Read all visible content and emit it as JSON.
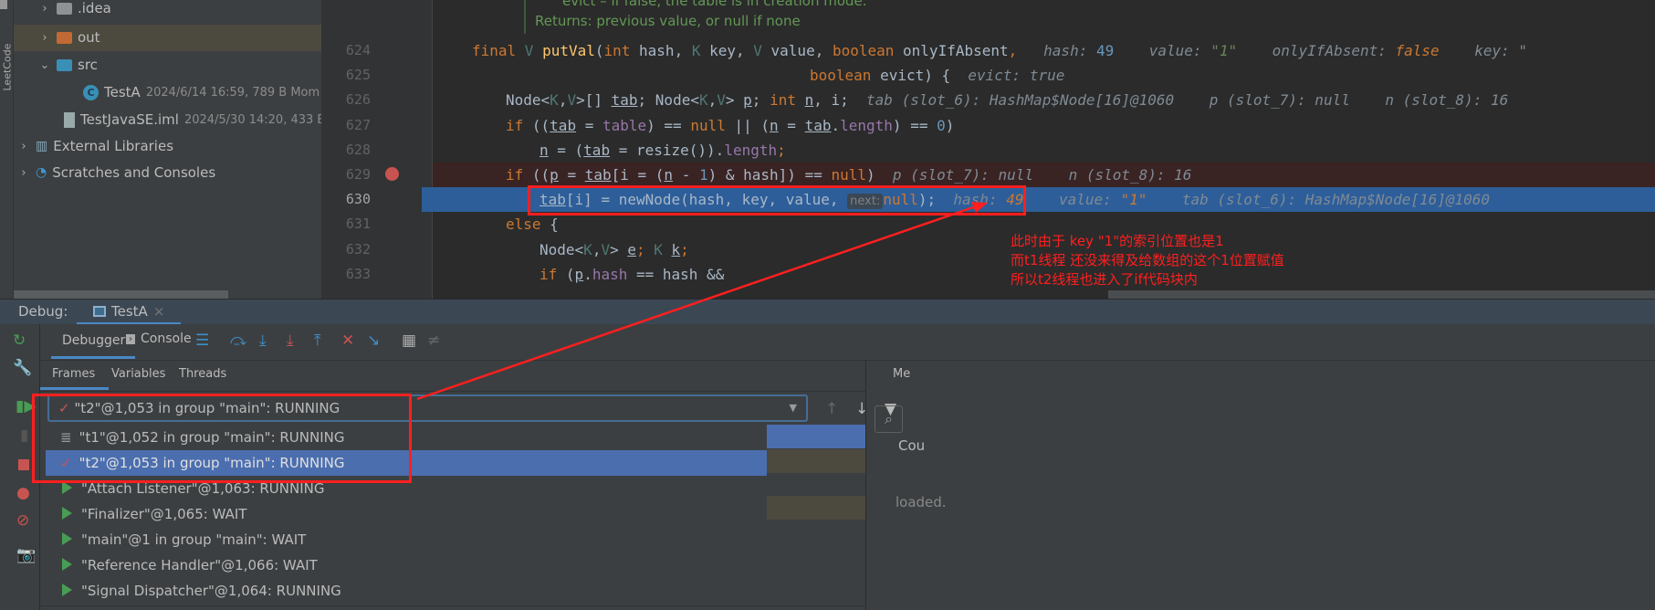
{
  "project_tree": [
    {
      "label": ".idea",
      "icon": "folder-icon",
      "color": "#8c9296",
      "expanded": false
    },
    {
      "label": "out",
      "icon": "folder-icon",
      "color": "#c26a35",
      "expanded": false,
      "selected": true
    },
    {
      "label": "src",
      "icon": "folder-icon",
      "color": "#3a8fb7",
      "expanded": true
    },
    {
      "label": "TestA",
      "meta": "2024/6/14 16:59, 789 B Mom",
      "icon": "java-class-icon"
    },
    {
      "label": "TestJavaSE.iml",
      "meta": "2024/5/30 14:20, 433 B",
      "icon": "iml-file-icon"
    },
    {
      "label": "External Libraries",
      "icon": "library-icon",
      "expanded": false
    },
    {
      "label": "Scratches and Consoles",
      "icon": "scratches-icon",
      "expanded": false
    }
  ],
  "side_label": "LeetCode",
  "doc": {
    "line1": "evict – if false, the table is in creation mode.",
    "line2": "Returns: previous value, or null if none"
  },
  "code_lines": [
    {
      "no": "624",
      "tokens": [
        [
          "k",
          "final "
        ],
        [
          "t",
          "V "
        ],
        [
          "m",
          "putVal"
        ],
        [
          "p",
          "("
        ],
        [
          "k",
          "int "
        ],
        [
          "p",
          "hash, "
        ],
        [
          "t",
          "K "
        ],
        [
          "p",
          "key, "
        ],
        [
          "t",
          "V "
        ],
        [
          "p",
          "value, "
        ],
        [
          "k",
          "boolean "
        ],
        [
          "p",
          "onlyIfAbsent"
        ],
        [
          "k",
          ","
        ],
        [
          "h",
          "   hash: "
        ],
        [
          "n",
          "49"
        ],
        [
          "h",
          "    value: "
        ],
        [
          "hs",
          "\"1\""
        ],
        [
          "h",
          "    onlyIfAbsent: "
        ],
        [
          "hv",
          "false"
        ],
        [
          "h",
          "    key: \""
        ]
      ],
      "indent": 0
    },
    {
      "no": "625",
      "tokens": [
        [
          "k",
          "boolean "
        ],
        [
          "p",
          "evict) {"
        ],
        [
          "h",
          "  evict: true"
        ]
      ],
      "indent": 10
    },
    {
      "no": "626",
      "tokens": [
        [
          "p",
          "Node<"
        ],
        [
          "t",
          "K"
        ],
        [
          "p",
          ","
        ],
        [
          "t",
          "V"
        ],
        [
          "p",
          ">[] "
        ],
        [
          "u",
          "tab"
        ],
        [
          "p",
          "; Node<"
        ],
        [
          "t",
          "K"
        ],
        [
          "p",
          ","
        ],
        [
          "t",
          "V"
        ],
        [
          "p",
          "> "
        ],
        [
          "u",
          "p"
        ],
        [
          "p",
          "; "
        ],
        [
          "k",
          "int "
        ],
        [
          "u",
          "n"
        ],
        [
          "p",
          ", i;"
        ],
        [
          "h",
          "  tab (slot_6): HashMap$Node[16]@1060    p (slot_7): null    n (slot_8): 16"
        ]
      ],
      "indent": 1
    },
    {
      "no": "627",
      "tokens": [
        [
          "k",
          "if "
        ],
        [
          "p",
          "(("
        ],
        [
          "u",
          "tab"
        ],
        [
          "p",
          " = "
        ],
        [
          "f",
          "table"
        ],
        [
          "p",
          ") == "
        ],
        [
          "k",
          "null "
        ],
        [
          "p",
          "|| ("
        ],
        [
          "u",
          "n"
        ],
        [
          "p",
          " = "
        ],
        [
          "u",
          "tab"
        ],
        [
          "p",
          "."
        ],
        [
          "f",
          "length"
        ],
        [
          "p",
          ") == "
        ],
        [
          "n",
          "0"
        ],
        [
          "p",
          ")"
        ]
      ],
      "indent": 1
    },
    {
      "no": "628",
      "tokens": [
        [
          "u",
          "n"
        ],
        [
          "p",
          " = ("
        ],
        [
          "u",
          "tab"
        ],
        [
          "p",
          " = resize())."
        ],
        [
          "f",
          "length"
        ],
        [
          "k",
          ";"
        ]
      ],
      "indent": 2
    },
    {
      "no": "629",
      "tokens": [
        [
          "k",
          "if "
        ],
        [
          "p",
          "(("
        ],
        [
          "u",
          "p"
        ],
        [
          "p",
          " = "
        ],
        [
          "u",
          "tab"
        ],
        [
          "p",
          "[i = ("
        ],
        [
          "u",
          "n"
        ],
        [
          "p",
          " - "
        ],
        [
          "n",
          "1"
        ],
        [
          "p",
          ") & hash]) == "
        ],
        [
          "k",
          "null"
        ],
        [
          "p",
          ")"
        ],
        [
          "h",
          "  p (slot_7): null    n (slot_8): 16"
        ]
      ],
      "indent": 1,
      "breakpoint": true
    },
    {
      "no": "630",
      "tokens": [
        [
          "u",
          "tab"
        ],
        [
          "p",
          "[i] = newNode(hash, key, value, "
        ],
        [
          "hint",
          "next:"
        ],
        [
          "k",
          "null"
        ],
        [
          "p",
          ");"
        ],
        [
          "h",
          "  hash: "
        ],
        [
          "hv",
          "49"
        ],
        [
          "h",
          "    value: "
        ],
        [
          "hv",
          "\"1\""
        ],
        [
          "h",
          "    tab (slot_6): HashMap$Node[16]@1060"
        ]
      ],
      "indent": 2,
      "current": true
    },
    {
      "no": "631",
      "tokens": [
        [
          "k",
          "else "
        ],
        [
          "p",
          "{"
        ]
      ],
      "indent": 1
    },
    {
      "no": "632",
      "tokens": [
        [
          "p",
          "Node<"
        ],
        [
          "t",
          "K"
        ],
        [
          "p",
          ","
        ],
        [
          "t",
          "V"
        ],
        [
          "p",
          "> "
        ],
        [
          "u",
          "e"
        ],
        [
          "k",
          "; "
        ],
        [
          "t",
          "K "
        ],
        [
          "u",
          "k"
        ],
        [
          "k",
          ";"
        ]
      ],
      "indent": 2
    },
    {
      "no": "633",
      "tokens": [
        [
          "k",
          "if "
        ],
        [
          "p",
          "("
        ],
        [
          "u",
          "p"
        ],
        [
          "p",
          "."
        ],
        [
          "f",
          "hash"
        ],
        [
          "p",
          " == hash &&"
        ]
      ],
      "indent": 2
    }
  ],
  "debug": {
    "label": "Debug:",
    "tab": "TestA"
  },
  "toolbar": {
    "debugger": "Debugger",
    "console": "Console"
  },
  "subtabs": [
    "Frames",
    "Variables",
    "Threads"
  ],
  "thread_selector": "\"t2\"@1,053 in group \"main\": RUNNING",
  "threads": [
    {
      "label": "\"t1\"@1,052 in group \"main\": RUNNING",
      "icon": "thread-suspended-icon"
    },
    {
      "label": "\"t2\"@1,053 in group \"main\": RUNNING",
      "icon": "check-icon",
      "selected": true
    },
    {
      "label": "\"Attach Listener\"@1,063: RUNNING",
      "icon": "play-icon"
    },
    {
      "label": "\"Finalizer\"@1,065: WAIT",
      "icon": "play-icon"
    },
    {
      "label": "\"main\"@1 in group \"main\": WAIT",
      "icon": "play-icon"
    },
    {
      "label": "\"Reference Handler\"@1,066: WAIT",
      "icon": "play-icon"
    },
    {
      "label": "\"Signal Dispatcher\"@1,064: RUNNING",
      "icon": "play-icon"
    }
  ],
  "right_panel": {
    "tab": "Me",
    "column": "Cou",
    "status": "loaded."
  },
  "annotation": {
    "lines": [
      "此时由于  key \"1\"的索引位置也是1",
      "而t1线程 还没来得及给数组的这个1位置赋值",
      "所以t2线程也进入了if代码块内"
    ],
    "color": "#ff1f1f"
  }
}
